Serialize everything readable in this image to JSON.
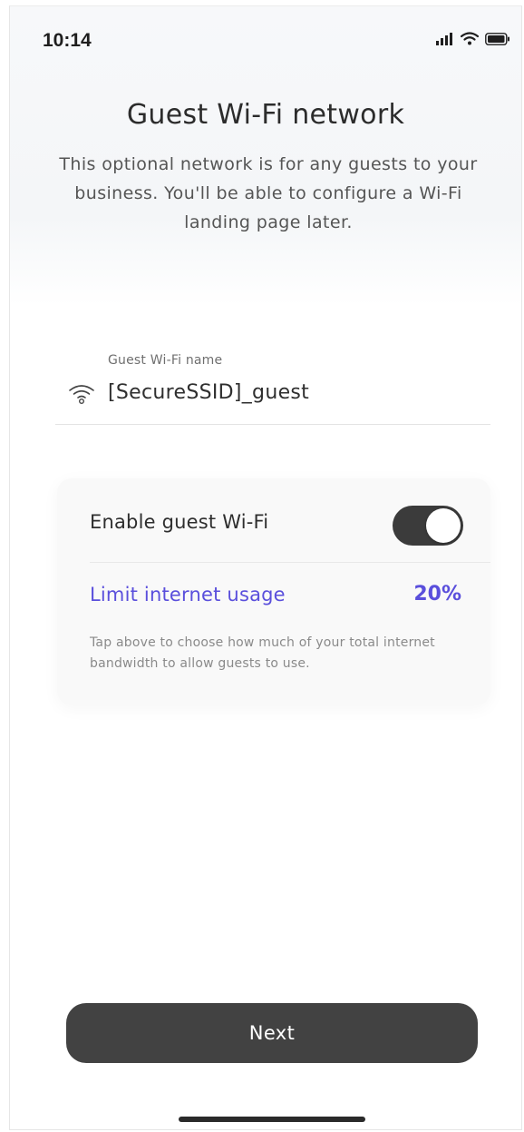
{
  "status_bar": {
    "time": "10:14",
    "icons": [
      "cellular-signal-icon",
      "wifi-icon",
      "battery-icon"
    ]
  },
  "header": {
    "title": "Guest Wi-Fi network",
    "subtitle": "This optional network is for any guests to your business. You'll be able to configure a Wi-Fi landing page later."
  },
  "name_field": {
    "label": "Guest Wi-Fi name",
    "value": "[SecureSSID]_guest",
    "icon": "wifi-icon"
  },
  "settings_card": {
    "enable_label": "Enable guest Wi-Fi",
    "enabled": true,
    "limit_label": "Limit internet usage",
    "limit_value": "20%",
    "helper_text": "Tap above to choose how much of your total internet bandwidth to allow guests to use."
  },
  "actions": {
    "next_label": "Next"
  },
  "colors": {
    "accent": "#5a4fdc",
    "button": "#424242",
    "toggle_on": "#3b3b3b"
  }
}
